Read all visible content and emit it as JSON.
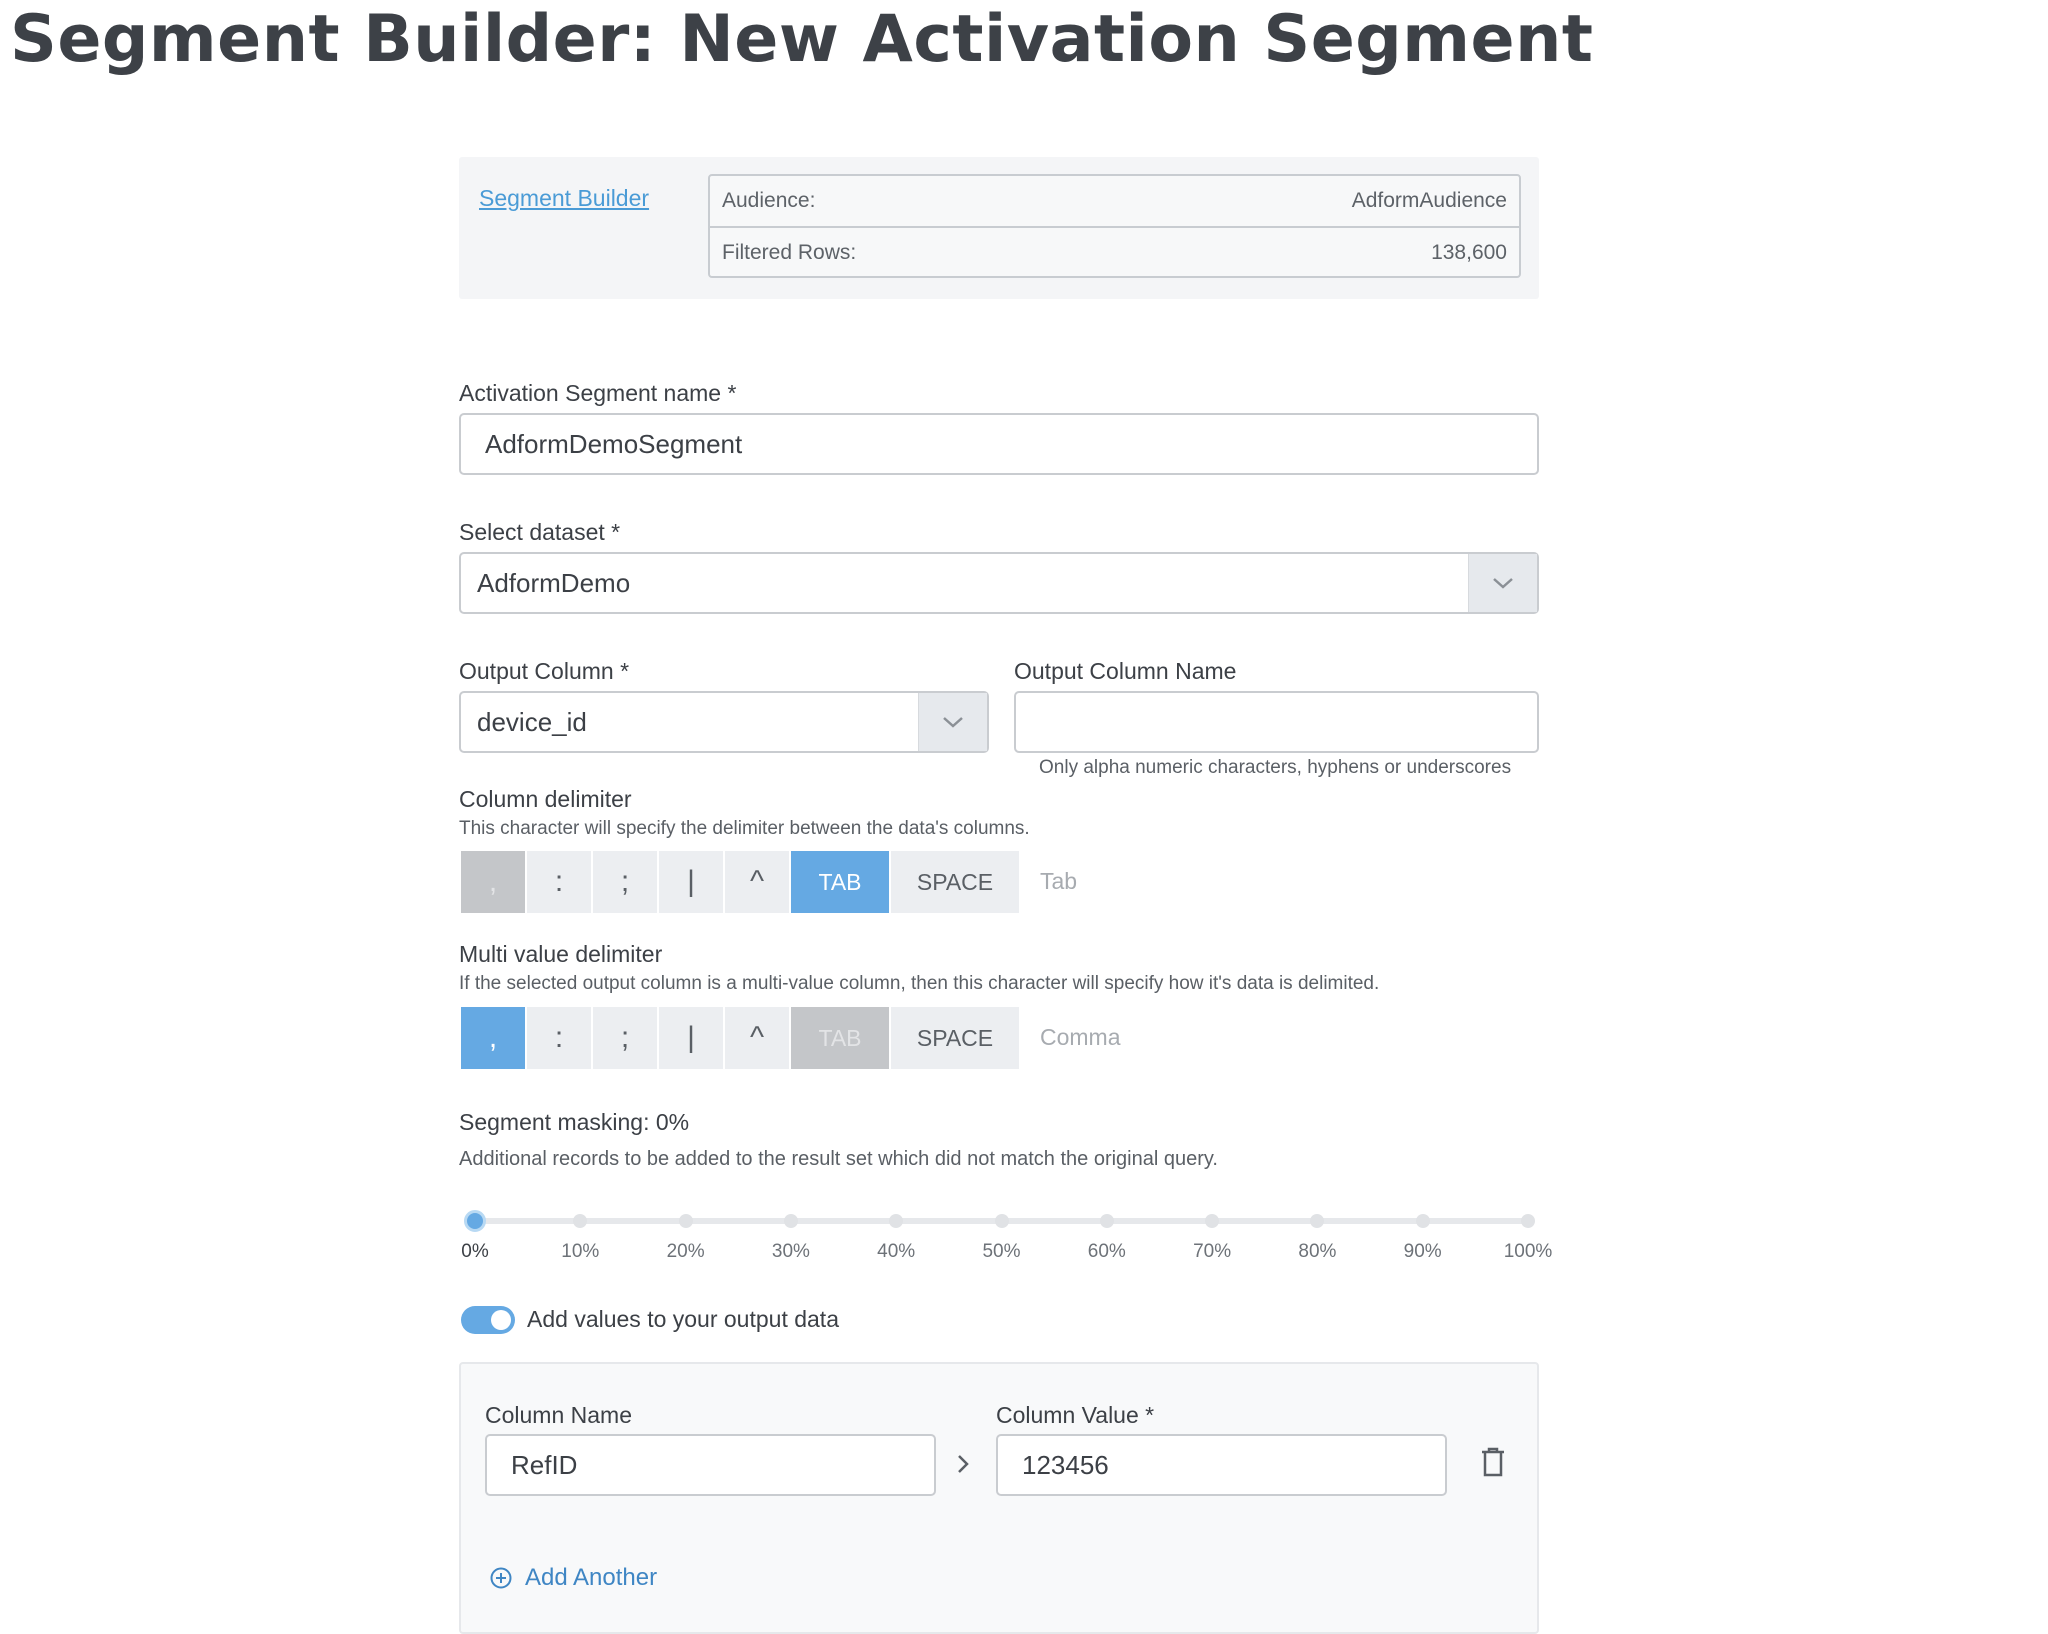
{
  "page": {
    "title": "Segment Builder: New Activation Segment"
  },
  "summary": {
    "breadcrumb": "Segment Builder",
    "audience_label": "Audience:",
    "audience_value": "AdformAudience",
    "rows_label": "Filtered Rows:",
    "rows_value": "138,600"
  },
  "segment_name": {
    "label": "Activation Segment name *",
    "value": "AdformDemoSegment"
  },
  "dataset": {
    "label": "Select dataset *",
    "value": "AdformDemo"
  },
  "output_column": {
    "label": "Output Column *",
    "value": "device_id"
  },
  "output_column_name": {
    "label": "Output Column Name",
    "value": "",
    "hint": "Only alpha numeric characters, hyphens or underscores"
  },
  "column_delimiter": {
    "label": "Column delimiter",
    "description": "This character will specify the delimiter between the data's columns.",
    "options": [
      ",",
      ":",
      ";",
      "|",
      "^",
      "TAB",
      "SPACE"
    ],
    "selected": "TAB",
    "disabled": ",",
    "selected_name": "Tab"
  },
  "multi_value_delimiter": {
    "label": "Multi value delimiter",
    "description": "If the selected output column is a multi-value column, then this character will specify how it's data is delimited.",
    "options": [
      ",",
      ":",
      ";",
      "|",
      "^",
      "TAB",
      "SPACE"
    ],
    "selected": ",",
    "disabled": "TAB",
    "selected_name": "Comma"
  },
  "masking": {
    "label": "Segment masking: 0%",
    "description": "Additional records to be added to the result set which did not match the original query.",
    "value_percent": 0,
    "steps": [
      "0%",
      "10%",
      "20%",
      "30%",
      "40%",
      "50%",
      "60%",
      "70%",
      "80%",
      "90%",
      "100%"
    ]
  },
  "add_values": {
    "toggle_label": "Add values to your output data",
    "enabled": true,
    "column_name_label": "Column Name",
    "column_name_value": "RefID",
    "column_value_label": "Column Value *",
    "column_value_value": "123456",
    "add_another": "Add Another"
  },
  "colors": {
    "accent": "#65a9e3",
    "link": "#4a9bd6",
    "disabled": "#c4c6c9"
  },
  "icons": [
    "chevron-down-icon",
    "chevron-right-icon",
    "trash-icon",
    "plus-circle-icon"
  ]
}
